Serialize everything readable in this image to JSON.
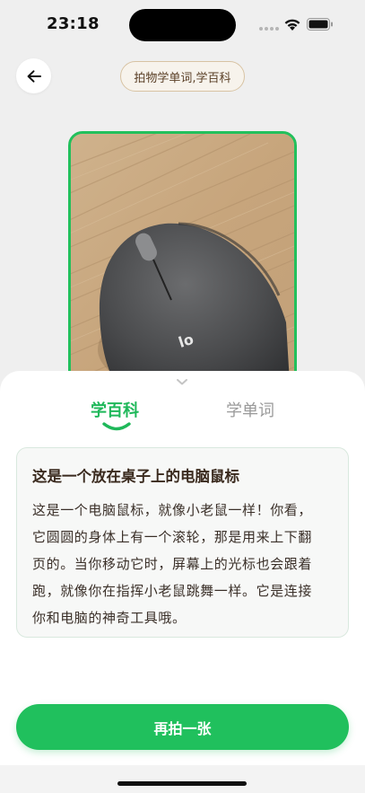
{
  "status_bar": {
    "time": "23:18"
  },
  "header": {
    "back_icon": "arrow-left-icon",
    "title": "拍物学单词,学百科"
  },
  "photo": {
    "description_icon": "captured-photo"
  },
  "sheet": {
    "tabs": [
      {
        "label": "学百科",
        "active": true
      },
      {
        "label": "学单词",
        "active": false
      }
    ],
    "card": {
      "title": "这是一个放在桌子上的电脑鼠标",
      "lines": [
        "这是一个电脑鼠标，就像小老鼠一样！你看，",
        "它圆圆的身体上有一个滚轮，那是用来上下翻",
        "页的。当你移动它时，屏幕上的光标也会跟着",
        "跑，就像你在指挥小老鼠跳舞一样。它是连接",
        "你和电脑的神奇工具哦。"
      ]
    },
    "cta_label": "再拍一张"
  },
  "colors": {
    "accent": "#20c05d",
    "pill_border": "#d8c3a3"
  }
}
